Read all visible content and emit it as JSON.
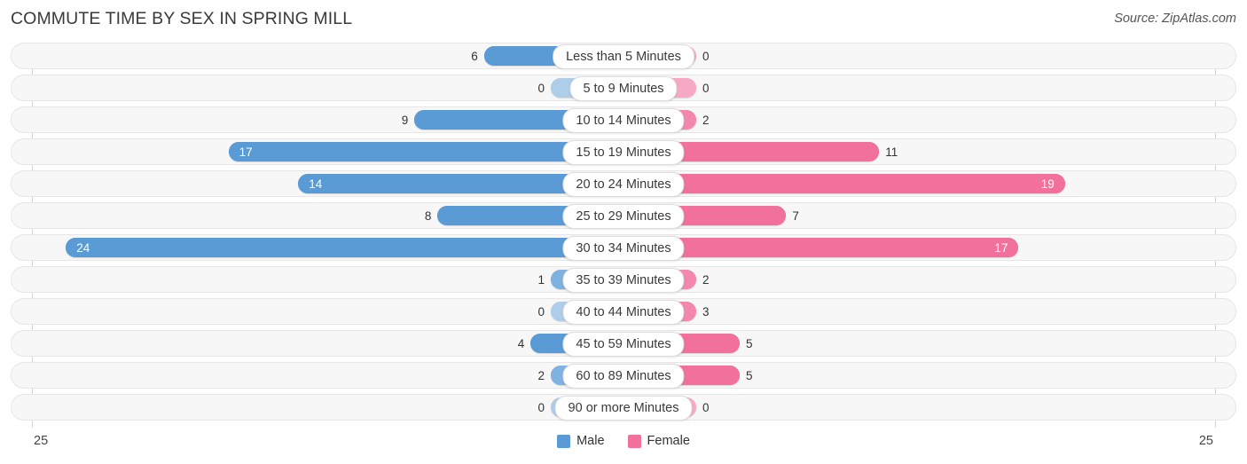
{
  "header": {
    "title": "COMMUTE TIME BY SEX IN SPRING MILL",
    "source": "Source: ZipAtlas.com"
  },
  "footer": {
    "axis_left": "25",
    "axis_right": "25",
    "legend": [
      {
        "label": "Male",
        "color": "#5b9bd5"
      },
      {
        "label": "Female",
        "color": "#f2709c"
      }
    ]
  },
  "colors": {
    "male": "#5b9bd5",
    "male_light": "#aecde9",
    "female": "#f2709c",
    "female_light": "#f7a8c4",
    "row_track": "#f7f7f7",
    "row_border": "#e6e6e6"
  },
  "chart_data": {
    "type": "bar",
    "orientation": "horizontal-diverging",
    "title": "COMMUTE TIME BY SEX IN SPRING MILL",
    "subtitle": "Source: ZipAtlas.com",
    "xlabel": "",
    "ylabel": "",
    "xlim": [
      25,
      25
    ],
    "axis_ticks": [
      "25",
      "25"
    ],
    "grid": false,
    "legend_position": "bottom-center",
    "categories": [
      "Less than 5 Minutes",
      "5 to 9 Minutes",
      "10 to 14 Minutes",
      "15 to 19 Minutes",
      "20 to 24 Minutes",
      "25 to 29 Minutes",
      "30 to 34 Minutes",
      "35 to 39 Minutes",
      "40 to 44 Minutes",
      "45 to 59 Minutes",
      "60 to 89 Minutes",
      "90 or more Minutes"
    ],
    "series": [
      {
        "name": "Male",
        "color": "#5b9bd5",
        "values": [
          6,
          0,
          9,
          17,
          14,
          8,
          24,
          1,
          0,
          4,
          2,
          0
        ]
      },
      {
        "name": "Female",
        "color": "#f2709c",
        "values": [
          0,
          0,
          2,
          11,
          19,
          7,
          17,
          2,
          3,
          5,
          5,
          0
        ]
      }
    ]
  },
  "rows": [
    {
      "label": "Less than 5 Minutes",
      "male": "6",
      "female": "0"
    },
    {
      "label": "5 to 9 Minutes",
      "male": "0",
      "female": "0"
    },
    {
      "label": "10 to 14 Minutes",
      "male": "9",
      "female": "2"
    },
    {
      "label": "15 to 19 Minutes",
      "male": "17",
      "female": "11"
    },
    {
      "label": "20 to 24 Minutes",
      "male": "14",
      "female": "19"
    },
    {
      "label": "25 to 29 Minutes",
      "male": "8",
      "female": "7"
    },
    {
      "label": "30 to 34 Minutes",
      "male": "24",
      "female": "17"
    },
    {
      "label": "35 to 39 Minutes",
      "male": "1",
      "female": "2"
    },
    {
      "label": "40 to 44 Minutes",
      "male": "0",
      "female": "3"
    },
    {
      "label": "45 to 59 Minutes",
      "male": "4",
      "female": "5"
    },
    {
      "label": "60 to 89 Minutes",
      "male": "2",
      "female": "5"
    },
    {
      "label": "90 or more Minutes",
      "male": "0",
      "female": "0"
    }
  ]
}
